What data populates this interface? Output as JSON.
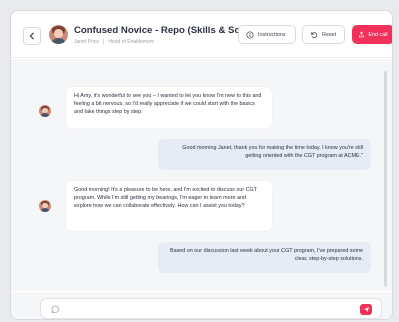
{
  "header": {
    "title": "Confused Novice - Repo (Skills & Scores)",
    "persona_name": "Janet Price",
    "persona_role": "Head of Enablement",
    "instructions_label": "Instructions",
    "reset_label": "Reset",
    "end_call_label": "End call"
  },
  "messages": [
    {
      "side": "left",
      "text": "Hi Amy, it's wonderful to see you – I wanted to let you know I'm new to this and feeling a bit nervous, so I'd really appreciate if we could start with the basics and take things step by step."
    },
    {
      "side": "right",
      "text": "Good morning Janet, thank you for making the time today. I know you're still getting oriented with the CGT program at ACME.\""
    },
    {
      "side": "left",
      "text": "Good morning! It's a pleasure to be here, and I'm excited to discuss our CGT program. While I'm still getting my bearings, I'm eager to learn more and explore how we can collaborate effectively. How can I assist you today?"
    },
    {
      "side": "right",
      "text": "Based on our discussion last week about your CGT program, I've prepared some clear, step-by-step solutions."
    }
  ],
  "composer": {
    "value": "",
    "placeholder": ""
  },
  "icons": {
    "back": "chevron-left-icon",
    "instructions": "info-circle-icon",
    "reset": "reset-icon",
    "end_call": "phone-exit-icon",
    "chat": "chat-bubble-icon",
    "send": "send-icon"
  },
  "colors": {
    "accent": "#f1315a",
    "user_bubble": "#e6ebf5",
    "persona_bubble": "#ffffff",
    "chat_background": "#f5f6f8"
  }
}
